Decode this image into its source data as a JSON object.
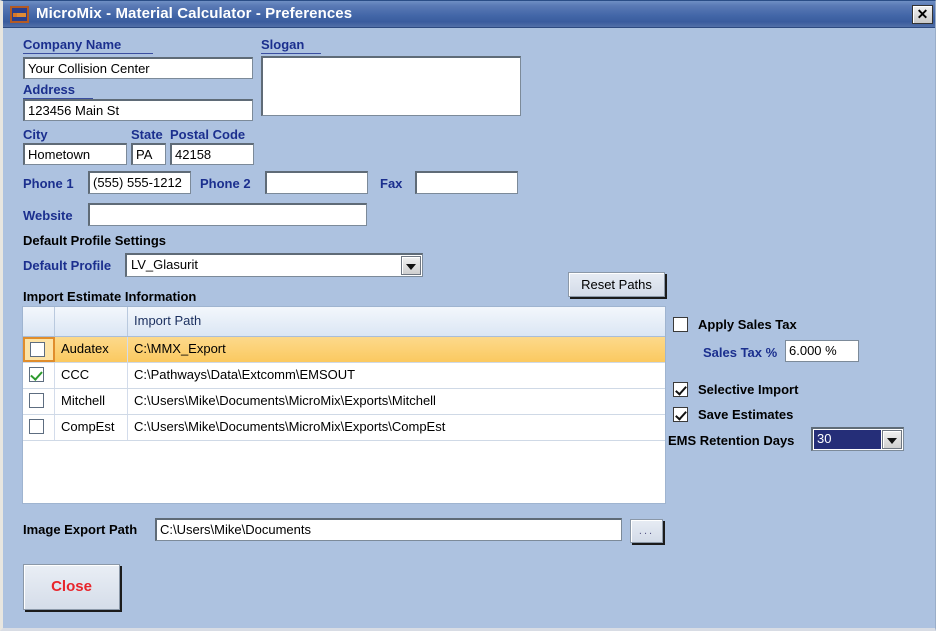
{
  "window": {
    "title": "MicroMix - Material Calculator - Preferences",
    "close_label": "✕",
    "icon": "app-icon"
  },
  "company": {
    "company_name_label": "Company Name",
    "company_name_value": "Your Collision Center",
    "slogan_label": "Slogan",
    "slogan_value": "",
    "address_label": "Address",
    "address_value": "123456 Main St",
    "city_label": "City",
    "city_value": "Hometown",
    "state_label": "State",
    "state_value": "PA",
    "postal_label": "Postal Code",
    "postal_value": "42158",
    "phone1_label": "Phone 1",
    "phone1_value": "(555) 555-1212",
    "phone2_label": "Phone 2",
    "phone2_value": "",
    "fax_label": "Fax",
    "fax_value": "",
    "website_label": "Website",
    "website_value": ""
  },
  "profile": {
    "section_label": "Default Profile Settings",
    "default_profile_label": "Default Profile",
    "default_profile_value": "LV_Glasurit"
  },
  "import_section": {
    "section_label": "Import Estimate Information",
    "reset_paths_label": "Reset Paths",
    "columns": [
      "",
      "",
      "Import Path"
    ],
    "rows": [
      {
        "checked": false,
        "name": "Audatex",
        "path": "C:\\MMX_Export",
        "selected": true
      },
      {
        "checked": true,
        "name": "CCC",
        "path": "C:\\Pathways\\Data\\Extcomm\\EMSOUT",
        "selected": false
      },
      {
        "checked": false,
        "name": "Mitchell",
        "path": "C:\\Users\\Mike\\Documents\\MicroMix\\Exports\\Mitchell",
        "selected": false
      },
      {
        "checked": false,
        "name": "CompEst",
        "path": "C:\\Users\\Mike\\Documents\\MicroMix\\Exports\\CompEst",
        "selected": false
      }
    ]
  },
  "options": {
    "apply_sales_tax_label": "Apply Sales Tax",
    "apply_sales_tax_checked": false,
    "sales_tax_pct_label": "Sales Tax %",
    "sales_tax_pct_value": "6.000 %",
    "selective_import_label": "Selective Import",
    "selective_import_checked": true,
    "save_estimates_label": "Save Estimates",
    "save_estimates_checked": true,
    "ems_retention_label": "EMS Retention Days",
    "ems_retention_value": "30"
  },
  "footer": {
    "image_export_label": "Image Export Path",
    "image_export_value": "C:\\Users\\Mike\\Documents",
    "browse_label": "...",
    "close_label": "Close"
  },
  "colors": {
    "window_bg": "#adc2e0",
    "title_bar": "#3a5c9e",
    "label_blue": "#1b2f8e",
    "selected_row": "#fbc960",
    "close_text_red": "#e8252b",
    "combo_selected_bg": "#252e78"
  }
}
